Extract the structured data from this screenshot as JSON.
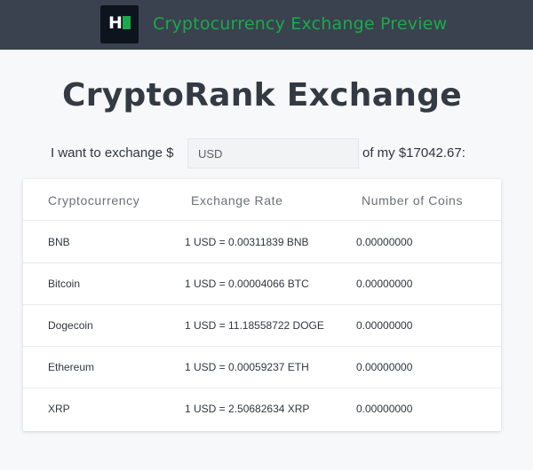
{
  "header": {
    "logo_letter": "H",
    "title": "Cryptocurrency Exchange Preview"
  },
  "main": {
    "headline": "CryptoRank Exchange",
    "exchange": {
      "prefix": "I want to exchange $",
      "input_placeholder": "USD",
      "input_value": "",
      "suffix": "of my $17042.67:"
    },
    "table": {
      "columns": [
        "Cryptocurrency",
        "Exchange Rate",
        "Number of Coins"
      ],
      "rows": [
        {
          "name": "BNB",
          "rate": "1 USD = 0.00311839 BNB",
          "coins": "0.00000000"
        },
        {
          "name": "Bitcoin",
          "rate": "1 USD = 0.00004066 BTC",
          "coins": "0.00000000"
        },
        {
          "name": "Dogecoin",
          "rate": "1 USD = 11.18558722 DOGE",
          "coins": "0.00000000"
        },
        {
          "name": "Ethereum",
          "rate": "1 USD = 0.00059237 ETH",
          "coins": "0.00000000"
        },
        {
          "name": "XRP",
          "rate": "1 USD = 2.50682634 XRP",
          "coins": "0.00000000"
        }
      ]
    }
  },
  "colors": {
    "topbar": "#39424e",
    "accent_green": "#1ba94c",
    "logo_bg": "#0e141e"
  }
}
